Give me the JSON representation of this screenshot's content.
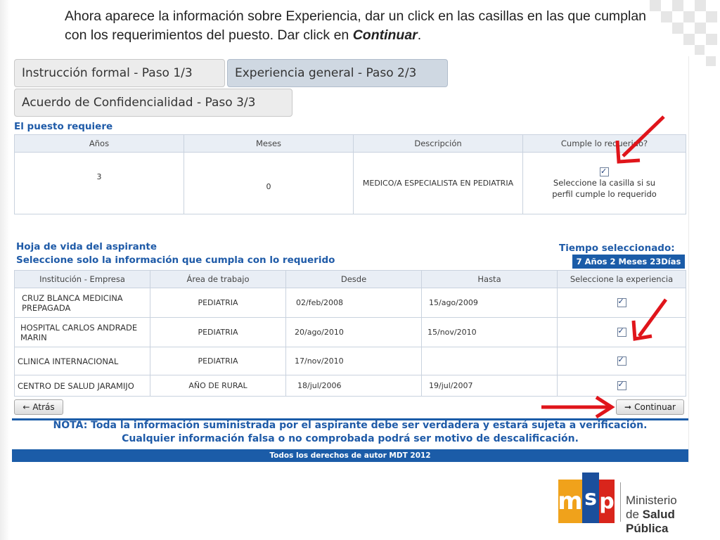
{
  "instruction": {
    "text": "Ahora aparece la información sobre Experiencia, dar un click en las casillas en las que cumplan con los requerimientos del puesto. Dar click en ",
    "emphasis": "Continuar",
    "end": "."
  },
  "tabs": [
    {
      "label": "Instrucción formal - Paso 1/3",
      "active": false
    },
    {
      "label": "Experiencia general - Paso 2/3",
      "active": true
    },
    {
      "label": "Acuerdo de Confidencialidad - Paso 3/3",
      "active": false
    }
  ],
  "requirement": {
    "title": "El puesto requiere",
    "headers": [
      "Años",
      "Meses",
      "Descripción",
      "Cumple lo requerido?"
    ],
    "row": {
      "years": "3",
      "months": "0",
      "description": "MEDICO/A ESPECIALISTA EN PEDIATRIA",
      "hint": "Seleccione la casilla si su perfil cumple lo requerido",
      "checked": true
    }
  },
  "cv": {
    "title": "Hoja de vida del aspirante",
    "subtitle": "Seleccione solo la información que cumpla con lo requerido",
    "time_label": "Tiempo seleccionado:",
    "time_years": "7 Años",
    "time_months": "2 Meses",
    "time_days": "23Días",
    "headers": [
      "Institución - Empresa",
      "Área de trabajo",
      "Desde",
      "Hasta",
      "Seleccione la experiencia"
    ],
    "rows": [
      {
        "institution": "CRUZ BLANCA MEDICINA PREPAGADA",
        "area": "PEDIATRIA",
        "from": "02/feb/2008",
        "to": "15/ago/2009",
        "checked": true
      },
      {
        "institution": "HOSPITAL CARLOS ANDRADE MARIN",
        "area": "PEDIATRIA",
        "from": "20/ago/2010",
        "to": "15/nov/2010",
        "checked": true
      },
      {
        "institution": "CLINICA INTERNACIONAL",
        "area": "PEDIATRIA",
        "from": "17/nov/2010",
        "to": "",
        "checked": true
      },
      {
        "institution": "CENTRO DE SALUD JARAMIJO",
        "area": "AÑO DE RURAL",
        "from": "18/jul/2006",
        "to": "19/jul/2007",
        "checked": true
      }
    ]
  },
  "buttons": {
    "back": "Atrás",
    "back_icon": "←",
    "continue": "Continuar",
    "continue_icon": "➞"
  },
  "note": {
    "line1": "NOTA: Toda la información suministrada por el aspirante debe ser verdadera y estará sujeta a verificación.",
    "line2": "Cualquier información falsa o no comprobada podrá ser motivo de descalificación."
  },
  "footer": "Todos los derechos de autor MDT 2012",
  "logo": {
    "letters": [
      "m",
      "s",
      "p"
    ],
    "line1": "Ministerio",
    "line2_a": "de ",
    "line2_b": "Salud Pública"
  },
  "colors": {
    "accent": "#1b5ca8",
    "arrow": "#e0151b"
  }
}
